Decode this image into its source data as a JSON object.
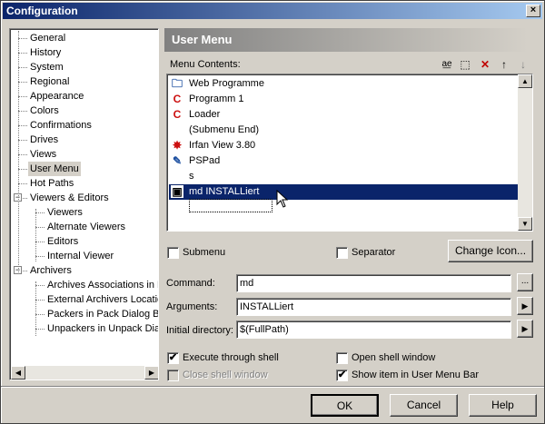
{
  "window": {
    "title": "Configuration",
    "close_glyph": "×"
  },
  "tree": {
    "items": [
      {
        "label": "General"
      },
      {
        "label": "History"
      },
      {
        "label": "System"
      },
      {
        "label": "Regional"
      },
      {
        "label": "Appearance"
      },
      {
        "label": "Colors"
      },
      {
        "label": "Confirmations"
      },
      {
        "label": "Drives"
      },
      {
        "label": "Views"
      },
      {
        "label": "User Menu",
        "selected": true
      },
      {
        "label": "Hot Paths"
      },
      {
        "label": "Viewers & Editors"
      },
      {
        "label": "Viewers"
      },
      {
        "label": "Alternate Viewers"
      },
      {
        "label": "Editors"
      },
      {
        "label": "Internal Viewer"
      },
      {
        "label": "Archivers"
      },
      {
        "label": "Archives Associations in P"
      },
      {
        "label": "External Archivers Locatio"
      },
      {
        "label": "Packers in Pack Dialog B"
      },
      {
        "label": "Unpackers in Unpack Dia"
      }
    ]
  },
  "panel": {
    "title": "User Menu",
    "menu_contents_label": "Menu Contents:",
    "toolbar_icons": [
      "rename-icon",
      "new-item-icon",
      "delete-icon",
      "move-up-icon",
      "move-down-icon"
    ],
    "menu_items": [
      {
        "label": "Web Programme",
        "icon": "folder-icon",
        "glyph": "🗀"
      },
      {
        "label": "Programm 1",
        "icon": "app-c-icon",
        "glyph": "C"
      },
      {
        "label": "Loader",
        "icon": "app-c-icon",
        "glyph": "C"
      },
      {
        "label": "(Submenu End)",
        "icon": "",
        "glyph": ""
      },
      {
        "label": "Irfan View 3.80",
        "icon": "irfanview-icon",
        "glyph": "✸"
      },
      {
        "label": "PSPad",
        "icon": "pspad-icon",
        "glyph": "✎"
      },
      {
        "label": "s",
        "icon": "",
        "glyph": ""
      },
      {
        "label": "md INSTALLiert",
        "icon": "command-icon",
        "glyph": "▣",
        "selected": true
      }
    ],
    "submenu_label": "Submenu",
    "separator_label": "Separator",
    "change_icon_label": "Change Icon...",
    "command_label": "Command:",
    "command_value": "md",
    "arguments_label": "Arguments:",
    "arguments_value": "INSTALLiert",
    "initial_dir_label": "Initial directory:",
    "initial_dir_value": "$(FullPath)",
    "browse_label": "...",
    "arrow_glyph": "▶",
    "execute_shell_label": "Execute through shell",
    "execute_shell_checked": true,
    "open_shell_label": "Open shell window",
    "open_shell_checked": false,
    "close_shell_label": "Close shell window",
    "show_menu_bar_label": "Show item in User Menu Bar",
    "show_menu_bar_checked": true
  },
  "footer": {
    "ok_label": "OK",
    "cancel_label": "Cancel",
    "help_label": "Help"
  },
  "check_glyph": "✔"
}
